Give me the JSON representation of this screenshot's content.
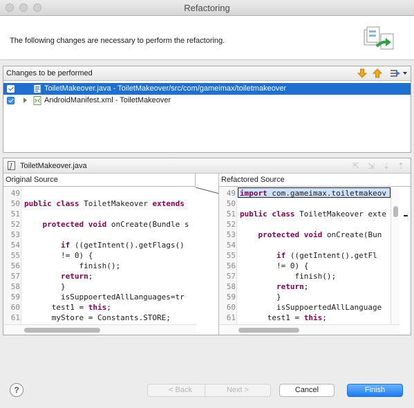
{
  "window": {
    "title": "Refactoring"
  },
  "header": {
    "message": "The following changes are necessary to perform the refactoring."
  },
  "changes": {
    "title": "Changes to be performed",
    "items": [
      {
        "label": "ToiletMakeover.java - ToiletMakeover/src/com/gameimax/toiletmakeover",
        "checked": true,
        "selected": true,
        "icon": "java-file-icon"
      },
      {
        "label": "AndroidManifest.xml - ToiletMakeover",
        "checked": true,
        "selected": false,
        "icon": "xml-file-icon"
      }
    ]
  },
  "compare": {
    "file_name": "ToiletMakeover.java",
    "original_label": "Original Source",
    "refactored_label": "Refactored Source",
    "original_lines": [
      {
        "n": "49",
        "text": ""
      },
      {
        "n": "50",
        "text": "public class ToiletMakeover extends "
      },
      {
        "n": "51",
        "text": ""
      },
      {
        "n": "52",
        "text": "    protected void onCreate(Bundle s"
      },
      {
        "n": "53",
        "text": ""
      },
      {
        "n": "54",
        "text": "        if ((getIntent().getFlags()"
      },
      {
        "n": "55",
        "text": "        != 0) {"
      },
      {
        "n": "56",
        "text": "            finish();"
      },
      {
        "n": "57",
        "text": "        return;"
      },
      {
        "n": "58",
        "text": "        }"
      },
      {
        "n": "59",
        "text": "        isSuppoertedAllLanguages=tr"
      },
      {
        "n": "60",
        "text": "      test1 = this;"
      },
      {
        "n": "61",
        "text": "      myStore = Constants.STORE;"
      }
    ],
    "refactored_lines": [
      {
        "n": "49",
        "text": "import com.gameimax.toiletmakeov"
      },
      {
        "n": "50",
        "text": ""
      },
      {
        "n": "51",
        "text": "public class ToiletMakeover exte"
      },
      {
        "n": "52",
        "text": ""
      },
      {
        "n": "53",
        "text": "    protected void onCreate(Bun"
      },
      {
        "n": "54",
        "text": ""
      },
      {
        "n": "55",
        "text": "        if ((getIntent().getFl"
      },
      {
        "n": "56",
        "text": "        != 0) {"
      },
      {
        "n": "57",
        "text": "            finish();"
      },
      {
        "n": "58",
        "text": "        return;"
      },
      {
        "n": "59",
        "text": "        }"
      },
      {
        "n": "60",
        "text": "        isSuppoertedAllLanguage"
      },
      {
        "n": "61",
        "text": "      test1 = this;"
      }
    ]
  },
  "buttons": {
    "back": "< Back",
    "next": "Next >",
    "cancel": "Cancel",
    "finish": "Finish",
    "help": "?"
  },
  "colors": {
    "selection": "#1f6fd0",
    "keyword": "#7f0055",
    "primary_button": "#1e7cf2"
  }
}
